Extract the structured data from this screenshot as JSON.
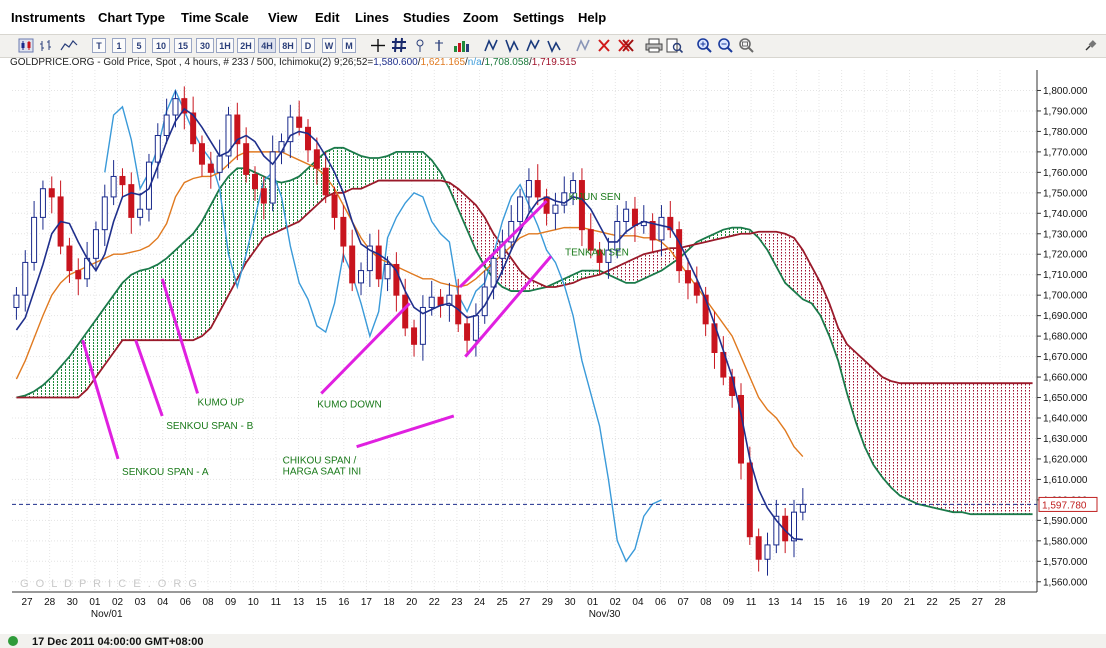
{
  "menu": {
    "items": [
      "Instruments",
      "Chart Type",
      "Time Scale",
      "View",
      "Edit",
      "Lines",
      "Studies",
      "Zoom",
      "Settings",
      "Help"
    ]
  },
  "toolbar": {
    "timeframes": [
      "T",
      "1",
      "5",
      "10",
      "15",
      "30",
      "1H",
      "2H",
      "4H",
      "8H",
      "D",
      "W",
      "M"
    ],
    "active_timeframe": "4H"
  },
  "chart_info": {
    "prefix": "GOLDPRICE.ORG - Gold Price, Spot , 4 hours, # 233 / 500, Ichimoku(2) 9;26;52=",
    "v1": "1,580.600",
    "v2": "1,621.165",
    "v3": "n/a",
    "v4": "1,708.058",
    "v5": "1,719.515",
    "colors": {
      "v1": "#1f2f8c",
      "v2": "#e07a20",
      "v3": "#3a9ad9",
      "v4": "#1a7a3a",
      "v5": "#a0122a"
    }
  },
  "watermark": "G O L D P R I C E . O R G",
  "status": {
    "text": "17 Dec 2011 04:00:00 GMT+08:00"
  },
  "colors": {
    "tenkan": "#1f2f8c",
    "kijun": "#e07a20",
    "chikou": "#3a9ad9",
    "span_a": "#1a7a4a",
    "span_b": "#9a1a2a",
    "kumo_up_fill": "#1f8a3a",
    "kumo_down_fill": "#a01030",
    "candle_up": "#1a2a8c",
    "candle_down": "#c8141e",
    "annotation_line": "#e020e0",
    "annotation_text": "#1a7a1a",
    "last_price_line": "#1f2f8c"
  },
  "chart_data": {
    "type": "candlestick",
    "title": "GOLDPRICE.ORG - Gold Price, Spot , 4 hours",
    "ylim": [
      1555,
      1810
    ],
    "y_ticks": [
      1560,
      1570,
      1580,
      1590,
      1600,
      1610,
      1620,
      1630,
      1640,
      1650,
      1660,
      1670,
      1680,
      1690,
      1700,
      1710,
      1720,
      1730,
      1740,
      1750,
      1760,
      1770,
      1780,
      1790,
      1800
    ],
    "x_tick_labels": [
      "27",
      "28",
      "30",
      "01",
      "02",
      "03",
      "04",
      "06",
      "08",
      "09",
      "10",
      "11",
      "13",
      "15",
      "16",
      "17",
      "18",
      "20",
      "22",
      "23",
      "24",
      "25",
      "27",
      "29",
      "30",
      "01",
      "02",
      "04",
      "06",
      "07",
      "08",
      "09",
      "11",
      "13",
      "14",
      "15",
      "16",
      "19",
      "20",
      "21",
      "22",
      "25",
      "27",
      "28"
    ],
    "x_month_labels": [
      {
        "label": "Nov/01",
        "tick_index": 3
      },
      {
        "label": "Nov/30",
        "tick_index": 25
      }
    ],
    "last_price": "1,597.780",
    "last_price_value": 1597.78,
    "total_slots": 116,
    "price_slots": 90,
    "chikou_start_slot": 10,
    "chikou_end_slot": 73,
    "close": [
      1700,
      1716,
      1738,
      1752,
      1748,
      1724,
      1712,
      1708,
      1718,
      1732,
      1748,
      1758,
      1754,
      1738,
      1742,
      1765,
      1778,
      1788,
      1796,
      1789,
      1774,
      1764,
      1760,
      1768,
      1788,
      1774,
      1759,
      1752,
      1745,
      1770,
      1775,
      1787,
      1782,
      1771,
      1762,
      1749,
      1738,
      1724,
      1706,
      1712,
      1724,
      1708,
      1715,
      1700,
      1684,
      1676,
      1694,
      1699,
      1695,
      1700,
      1686,
      1678,
      1690,
      1704,
      1718,
      1726,
      1736,
      1748,
      1756,
      1748,
      1740,
      1744,
      1750,
      1756,
      1732,
      1722,
      1716,
      1722,
      1736,
      1742,
      1734,
      1736,
      1727,
      1738,
      1732,
      1712,
      1706,
      1700,
      1686,
      1672,
      1660,
      1651,
      1618,
      1582,
      1571,
      1578,
      1592,
      1580,
      1594,
      1597.78
    ],
    "tenkan": [
      1683,
      1689,
      1702,
      1715,
      1730,
      1736,
      1735,
      1726,
      1718,
      1712,
      1720,
      1736,
      1748,
      1750,
      1749,
      1752,
      1763,
      1775,
      1785,
      1791,
      1788,
      1782,
      1775,
      1768,
      1770,
      1776,
      1778,
      1775,
      1768,
      1764,
      1770,
      1778,
      1780,
      1779,
      1775,
      1768,
      1760,
      1750,
      1736,
      1725,
      1722,
      1720,
      1717,
      1712,
      1702,
      1694,
      1691,
      1693,
      1695,
      1696,
      1693,
      1689,
      1690,
      1695,
      1703,
      1712,
      1722,
      1731,
      1740,
      1746,
      1748,
      1746,
      1745,
      1748,
      1747,
      1742,
      1734,
      1726,
      1726,
      1731,
      1734,
      1736,
      1735,
      1734,
      1733,
      1726,
      1717,
      1708,
      1698,
      1686,
      1673,
      1660,
      1642,
      1620,
      1605,
      1596,
      1590,
      1585,
      1581,
      1580.6
    ],
    "kijun": [
      1659,
      1668,
      1679,
      1690,
      1700,
      1706,
      1710,
      1712,
      1714,
      1716,
      1718,
      1720,
      1720,
      1721,
      1722,
      1724,
      1728,
      1735,
      1748,
      1755,
      1757,
      1758,
      1758,
      1760,
      1764,
      1768,
      1770,
      1770,
      1770,
      1770,
      1770,
      1768,
      1766,
      1764,
      1762,
      1758,
      1752,
      1744,
      1736,
      1728,
      1722,
      1718,
      1716,
      1714,
      1712,
      1710,
      1708,
      1708,
      1706,
      1705,
      1704,
      1705,
      1708,
      1712,
      1716,
      1720,
      1724,
      1728,
      1730,
      1730,
      1731,
      1732,
      1733,
      1733,
      1733,
      1732,
      1731,
      1730,
      1729,
      1729,
      1729,
      1728,
      1728,
      1726,
      1722,
      1716,
      1710,
      1704,
      1698,
      1692,
      1686,
      1680,
      1670,
      1660,
      1650,
      1644,
      1640,
      1634,
      1626,
      1621.165
    ],
    "chikou": [
      1760,
      1788,
      1792,
      1776,
      1752,
      1760,
      1772,
      1790,
      1800,
      1790,
      1780,
      1772,
      1766,
      1752,
      1720,
      1704,
      1720,
      1738,
      1756,
      1760,
      1748,
      1724,
      1706,
      1698,
      1685,
      1682,
      1696,
      1720,
      1710,
      1696,
      1680,
      1692,
      1728,
      1738,
      1745,
      1750,
      1748,
      1736,
      1730,
      1726,
      1700,
      1692,
      1702,
      1706,
      1720,
      1736,
      1748,
      1754,
      1744,
      1734,
      1722,
      1716,
      1705,
      1690,
      1668,
      1652,
      1636,
      1610,
      1580,
      1570,
      1576,
      1592,
      1598,
      1600
    ],
    "span_a": [
      1650,
      1651,
      1653,
      1656,
      1660,
      1665,
      1670,
      1676,
      1682,
      1688,
      1694,
      1700,
      1706,
      1710,
      1712,
      1713,
      1715,
      1718,
      1722,
      1726,
      1730,
      1736,
      1744,
      1752,
      1758,
      1762,
      1762,
      1760,
      1758,
      1756,
      1755,
      1756,
      1758,
      1762,
      1766,
      1770,
      1772,
      1772,
      1770,
      1768,
      1767,
      1767,
      1768,
      1770,
      1770,
      1770,
      1770,
      1766,
      1760,
      1752,
      1742,
      1732,
      1722,
      1714,
      1708,
      1704,
      1702,
      1702,
      1702,
      1703,
      1704,
      1706,
      1708,
      1710,
      1712,
      1712,
      1712,
      1710,
      1708,
      1706,
      1706,
      1708,
      1710,
      1712,
      1715,
      1718,
      1722,
      1726,
      1728,
      1730,
      1732,
      1733,
      1733,
      1732,
      1728,
      1722,
      1714,
      1706,
      1702,
      1698,
      1696,
      1690,
      1680,
      1668,
      1652,
      1638,
      1626,
      1617,
      1611,
      1606,
      1602,
      1600,
      1598,
      1597,
      1596,
      1595,
      1594,
      1594,
      1593,
      1593,
      1593,
      1593,
      1593,
      1593,
      1593,
      1593
    ],
    "span_b": [
      1650,
      1650,
      1650,
      1650,
      1650,
      1650,
      1650,
      1650,
      1654,
      1660,
      1666,
      1672,
      1678,
      1678,
      1678,
      1678,
      1678,
      1678,
      1678,
      1678,
      1678,
      1680,
      1684,
      1692,
      1700,
      1708,
      1716,
      1722,
      1728,
      1730,
      1732,
      1734,
      1736,
      1740,
      1744,
      1748,
      1750,
      1750,
      1752,
      1752,
      1754,
      1756,
      1756,
      1756,
      1756,
      1756,
      1756,
      1756,
      1756,
      1755,
      1752,
      1748,
      1744,
      1738,
      1730,
      1724,
      1718,
      1712,
      1708,
      1706,
      1704,
      1704,
      1705,
      1706,
      1708,
      1709,
      1710,
      1712,
      1714,
      1716,
      1718,
      1720,
      1721,
      1722,
      1723,
      1723,
      1724,
      1725,
      1726,
      1727,
      1728,
      1729,
      1730,
      1730,
      1731,
      1731,
      1731,
      1730,
      1728,
      1722,
      1714,
      1706,
      1696,
      1684,
      1676,
      1672,
      1668,
      1664,
      1660,
      1658,
      1657,
      1657,
      1657,
      1657,
      1657,
      1657,
      1657,
      1657,
      1657,
      1657,
      1657,
      1657,
      1657,
      1657,
      1657,
      1657
    ],
    "annotations": [
      {
        "text": "SENKOU SPAN - A",
        "slot": 11.5,
        "value": 1620,
        "tip_slot": 7.5,
        "tip_value": 1678
      },
      {
        "text": "SENKOU SPAN - B",
        "slot": 16.5,
        "value": 1641,
        "tip_slot": 13.5,
        "tip_value": 1678
      },
      {
        "text": "KUMO UP",
        "slot": 20.5,
        "value": 1652,
        "tip_slot": 16.5,
        "tip_value": 1708
      },
      {
        "text": "KUMO DOWN",
        "slot": 34.5,
        "value": 1652,
        "tip_slot": 44.5,
        "tip_value": 1696
      },
      {
        "text": "CHIKOU SPAN / HARGA SAAT INI",
        "slot": 38.5,
        "value": 1626,
        "tip_slot": 49.5,
        "tip_value": 1641
      },
      {
        "text": "KIJUN SEN",
        "slot": 60,
        "value": 1746,
        "tip_slot": 50.2,
        "tip_value": 1704
      },
      {
        "text": "TENKAN SEN",
        "slot": 60.5,
        "value": 1719,
        "tip_slot": 50.8,
        "tip_value": 1670
      }
    ]
  }
}
